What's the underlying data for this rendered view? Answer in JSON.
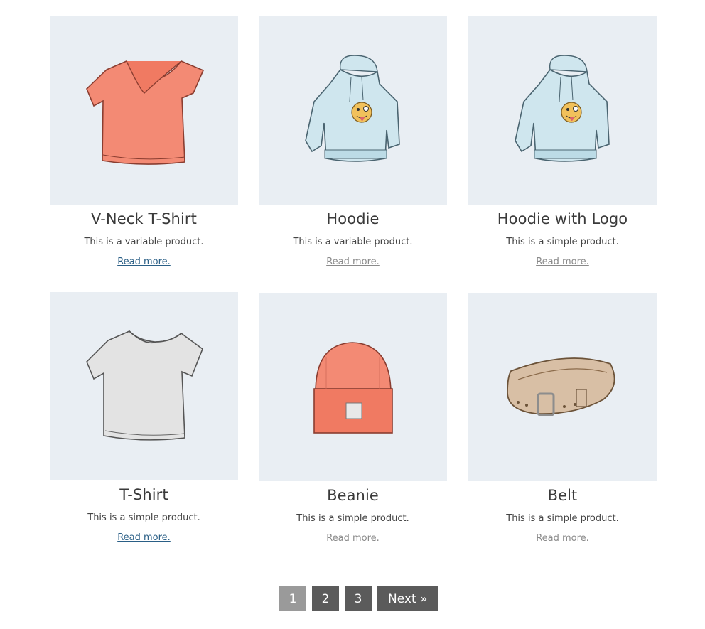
{
  "products": [
    {
      "title": "V-Neck T-Shirt",
      "description": "This is a variable product.",
      "link": "Read more.",
      "image": "vneck-tshirt-image"
    },
    {
      "title": "Hoodie",
      "description": "This is a variable product.",
      "link": "Read more.",
      "image": "hoodie-image"
    },
    {
      "title": "Hoodie with Logo",
      "description": "This is a simple product.",
      "link": "Read more.",
      "image": "hoodie-with-logo-image"
    },
    {
      "title": "T-Shirt",
      "description": "This is a simple product.",
      "link": "Read more.",
      "image": "tshirt-image"
    },
    {
      "title": "Beanie",
      "description": "This is a simple product.",
      "link": "Read more.",
      "image": "beanie-image"
    },
    {
      "title": "Belt",
      "description": "This is a simple product.",
      "link": "Read more.",
      "image": "belt-image"
    }
  ],
  "pagination": {
    "pages": [
      "1",
      "2",
      "3"
    ],
    "current": "1",
    "next_label": "Next »"
  },
  "colors": {
    "thumb_bg": "#e9eef3",
    "link_active": "#2a5f86",
    "link_muted": "#8a8a8a",
    "page_button": "#5b5b5b",
    "page_current": "#9a9a9a"
  }
}
